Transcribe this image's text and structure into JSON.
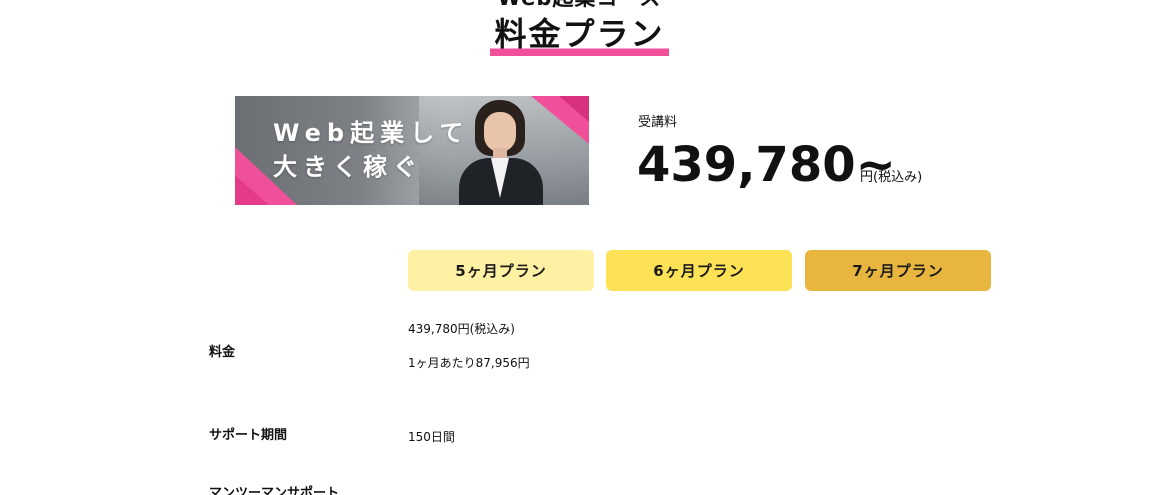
{
  "section": {
    "kicker": "Web起業コース",
    "title": "料金プラン",
    "accent_color": "#f0509a"
  },
  "banner": {
    "line1": "Web起業して",
    "line2": "大きく稼ぐ"
  },
  "fee": {
    "label": "受講料",
    "amount": "439,780~",
    "unit": "円(税込み)"
  },
  "plans": [
    {
      "label": "5ヶ月プラン",
      "color": "#fef1a4"
    },
    {
      "label": "6ヶ月プラン",
      "color": "#fde255"
    },
    {
      "label": "7ヶ月プラン",
      "color": "#e8b63f"
    }
  ],
  "details": {
    "price": {
      "label": "料金",
      "value": "439,780円(税込み)",
      "monthly": "1ヶ月あたり87,956円"
    },
    "support": {
      "label": "サポート期間",
      "value": "150日間"
    },
    "next_row": {
      "label": "マンツーマンサポート"
    }
  }
}
